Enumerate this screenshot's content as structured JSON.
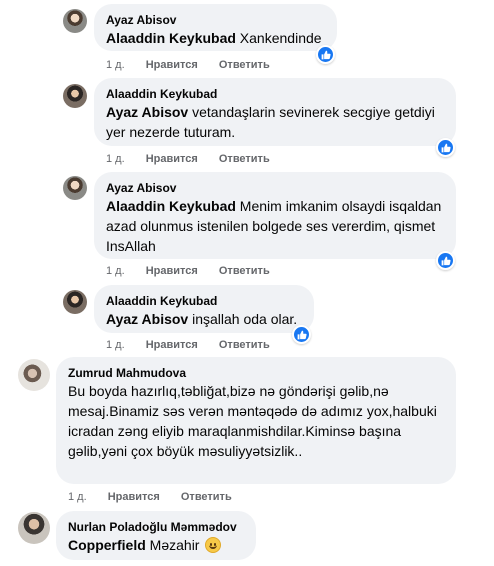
{
  "comments": [
    {
      "author": "Ayaz Abisov",
      "mention": "Alaaddin Keykubad",
      "text": " Xankendinde",
      "age": "1 д.",
      "like_label": "Нравится",
      "reply_label": "Ответить",
      "reaction": "like-icon"
    },
    {
      "author": "Alaaddin Keykubad",
      "mention": "Ayaz Abisov",
      "text": " vetandaşlarin sevinerek secgiye getdiyi yer nezerde tuturam.",
      "age": "1 д.",
      "like_label": "Нравится",
      "reply_label": "Ответить",
      "reaction": "like-icon"
    },
    {
      "author": "Ayaz Abisov",
      "mention": "Alaaddin Keykubad",
      "text": " Menim imkanim olsaydi isqaldan azad olunmus istenilen bolgede ses vererdim, qismet InsAllah",
      "age": "1 д.",
      "like_label": "Нравится",
      "reply_label": "Ответить",
      "reaction": "like-icon"
    },
    {
      "author": "Alaaddin Keykubad",
      "mention": "Ayaz Abisov",
      "text": " inşallah oda olar.",
      "age": "1 д.",
      "like_label": "Нравится",
      "reply_label": "Ответить",
      "reaction": "like-icon"
    },
    {
      "author": "Zumrud Mahmudova",
      "mention": "",
      "text": "Bu boyda hazırlıq,təbliğat,bizə nə göndərişi gəlib,nə mesaj.Binamiz səs verən məntəqədə də adımız yox,halbuki icradan zəng eliyib maraqlanmishdilar.Kiminsə başına gəlib,yəni çox böyük məsuliyyətsizlik..",
      "age": "1 д.",
      "like_label": "Нравится",
      "reply_label": "Ответить"
    },
    {
      "author": "Nurlan Poladoğlu Məmmədov",
      "mention": "Copperfield",
      "text": " Məzahir ",
      "emoji": "smile-emoji"
    }
  ],
  "colors": {
    "bubble_bg": "#f0f2f5",
    "meta_text": "#65676b",
    "like_blue": "#1877f2"
  }
}
